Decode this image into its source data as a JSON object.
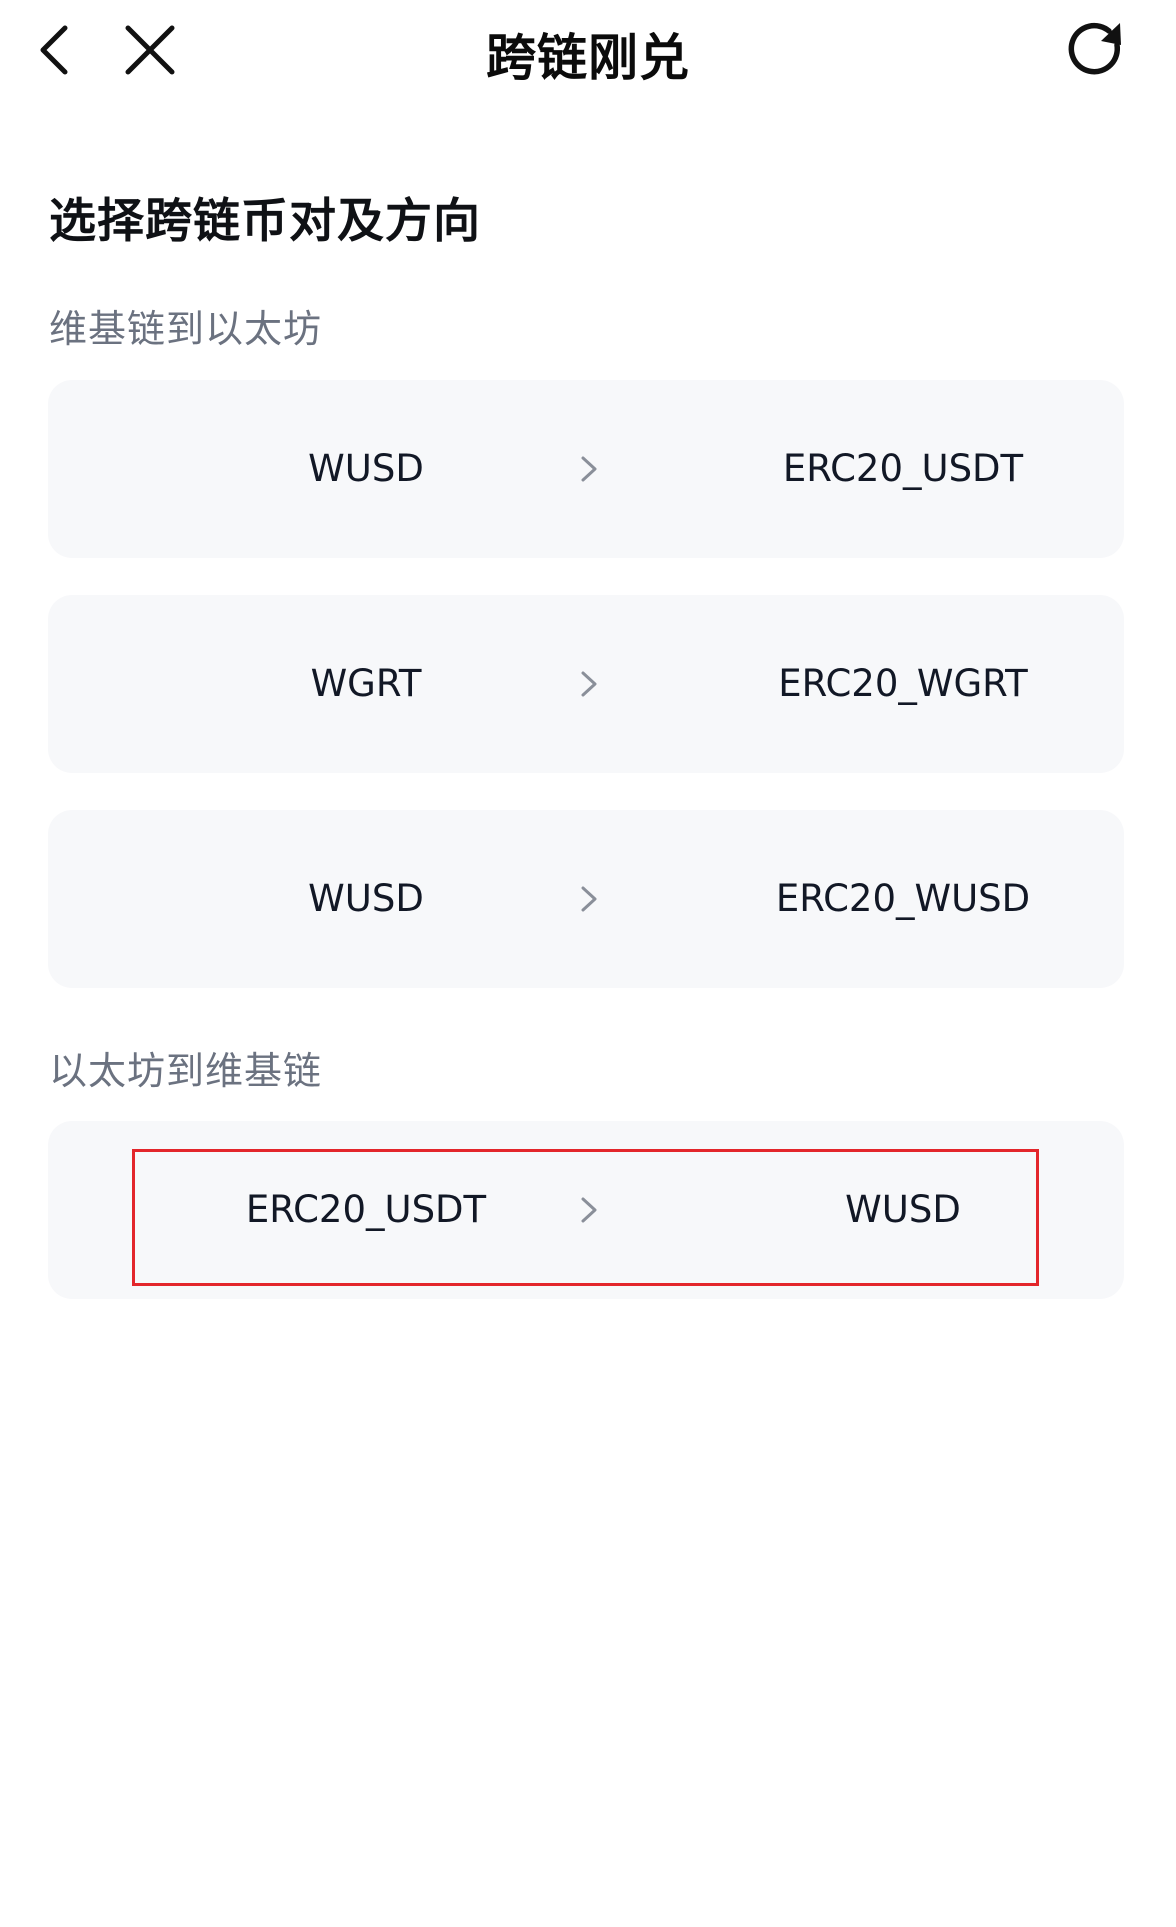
{
  "header": {
    "title": "跨链刚兑",
    "back_icon": "chevron-left-icon",
    "close_icon": "close-icon",
    "refresh_icon": "refresh-icon"
  },
  "main": {
    "section_title": "选择跨链币对及方向",
    "groups": [
      {
        "label": "维基链到以太坊",
        "pairs": [
          {
            "from": "WUSD",
            "to": "ERC20_USDT"
          },
          {
            "from": "WGRT",
            "to": "ERC20_WGRT"
          },
          {
            "from": "WUSD",
            "to": "ERC20_WUSD"
          }
        ]
      },
      {
        "label": "以太坊到维基链",
        "pairs": [
          {
            "from": "ERC20_USDT",
            "to": "WUSD"
          }
        ]
      }
    ]
  },
  "colors": {
    "card_background": "#f7f8fa",
    "highlight_border": "#e3262b",
    "label_gray": "#6b7280"
  }
}
